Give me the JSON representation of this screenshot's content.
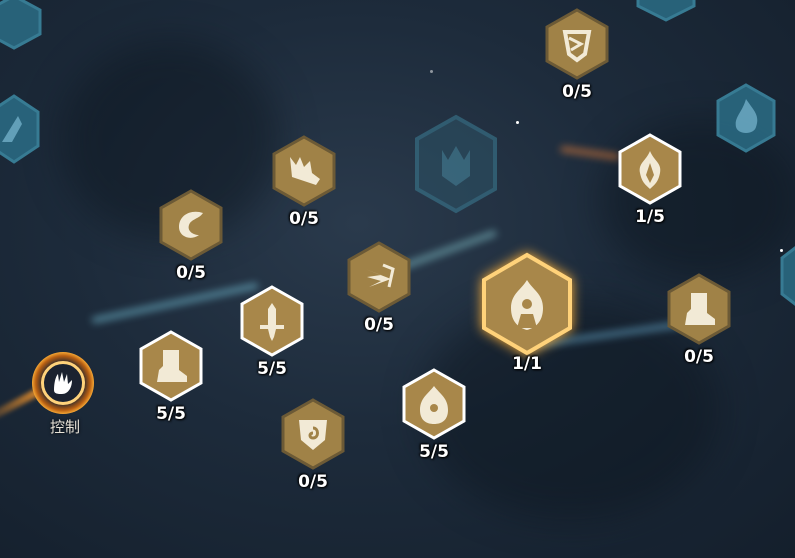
{
  "colors": {
    "gold": "#a8874a",
    "gold_dark": "#7a6233",
    "border_active": "#ffffff",
    "border_inactive": "#5f5a4e",
    "teal_locked": "#2f6f86",
    "glow": "#ffb23a"
  },
  "category": {
    "label": "控制",
    "icon": "claw-icon"
  },
  "nodes": [
    {
      "id": "n1",
      "icon": "shield-arrow-icon",
      "count": "0/5",
      "active": false
    },
    {
      "id": "n2",
      "icon": "flaming-crown-icon",
      "count": "1/5",
      "active": true
    },
    {
      "id": "n3",
      "icon": "jagged-sword-icon",
      "count": "0/5",
      "active": false
    },
    {
      "id": "n4",
      "icon": "dragon-swirl-icon",
      "count": "0/5",
      "active": false
    },
    {
      "id": "n5",
      "icon": "winged-arrow-icon",
      "count": "0/5",
      "active": false
    },
    {
      "id": "n6",
      "icon": "sword-icon",
      "count": "5/5",
      "active": true
    },
    {
      "id": "n7",
      "icon": "burning-figure-icon",
      "count": "1/1",
      "active": true,
      "keystone": true
    },
    {
      "id": "n8",
      "icon": "boot-icon",
      "count": "0/5",
      "active": false
    },
    {
      "id": "n9",
      "icon": "boot-icon",
      "count": "5/5",
      "active": true
    },
    {
      "id": "n10",
      "icon": "flame-figure-icon",
      "count": "5/5",
      "active": true
    },
    {
      "id": "n11",
      "icon": "spiral-shield-icon",
      "count": "0/5",
      "active": false
    }
  ],
  "locked_nodes": [
    "crown-emblem-icon",
    "fire-emblem-icon",
    "claw-emblem-icon"
  ]
}
